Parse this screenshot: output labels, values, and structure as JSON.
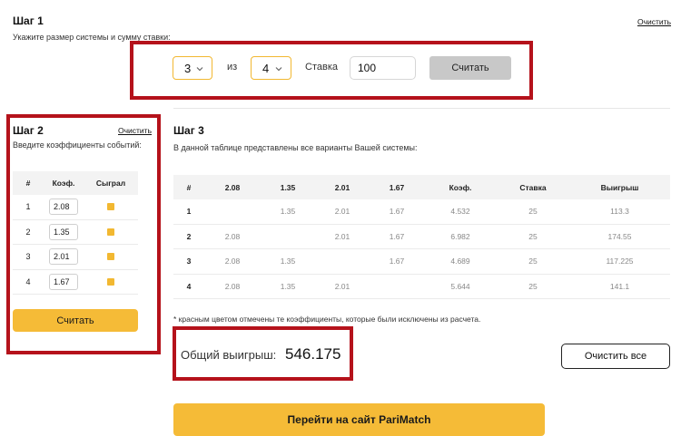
{
  "step1": {
    "title": "Шаг 1",
    "subtitle": "Укажите размер системы и сумму ставки:",
    "clear_label": "Очистить",
    "system_size": "3",
    "system_of_label": "из",
    "system_total": "4",
    "stake_label": "Ставка",
    "stake_value": "100",
    "calc_button": "Считать"
  },
  "step2": {
    "title": "Шаг 2",
    "clear_label": "Очистить",
    "subtitle": "Введите коэффициенты событий:",
    "headers": {
      "num": "#",
      "koef": "Коэф.",
      "won": "Сыграл"
    },
    "rows": [
      {
        "num": "1",
        "koef": "2.08",
        "won": true
      },
      {
        "num": "2",
        "koef": "1.35",
        "won": true
      },
      {
        "num": "3",
        "koef": "2.01",
        "won": true
      },
      {
        "num": "4",
        "koef": "1.67",
        "won": true
      }
    ],
    "calc_button": "Считать"
  },
  "step3": {
    "title": "Шаг 3",
    "subtitle": "В данной таблице представлены все варианты Вашей системы:",
    "headers": [
      "#",
      "2.08",
      "1.35",
      "2.01",
      "1.67",
      "Коэф.",
      "Ставка",
      "Выигрыш"
    ],
    "rows": [
      [
        "1",
        "",
        "1.35",
        "2.01",
        "1.67",
        "4.532",
        "25",
        "113.3"
      ],
      [
        "2",
        "2.08",
        "",
        "2.01",
        "1.67",
        "6.982",
        "25",
        "174.55"
      ],
      [
        "3",
        "2.08",
        "1.35",
        "",
        "1.67",
        "4.689",
        "25",
        "117.225"
      ],
      [
        "4",
        "2.08",
        "1.35",
        "2.01",
        "",
        "5.644",
        "25",
        "141.1"
      ]
    ],
    "note": "* красным цветом отмечены те коэффициенты, которые были исключены из расчета.",
    "total_label": "Общий выигрыш:",
    "total_value": "546.175",
    "clear_all_button": "Очистить все"
  },
  "cta_button": "Перейти на сайт PariMatch",
  "colors": {
    "accent": "#f5bb37",
    "highlight_border": "#b5121b",
    "grey_button": "#c8c8c8"
  }
}
